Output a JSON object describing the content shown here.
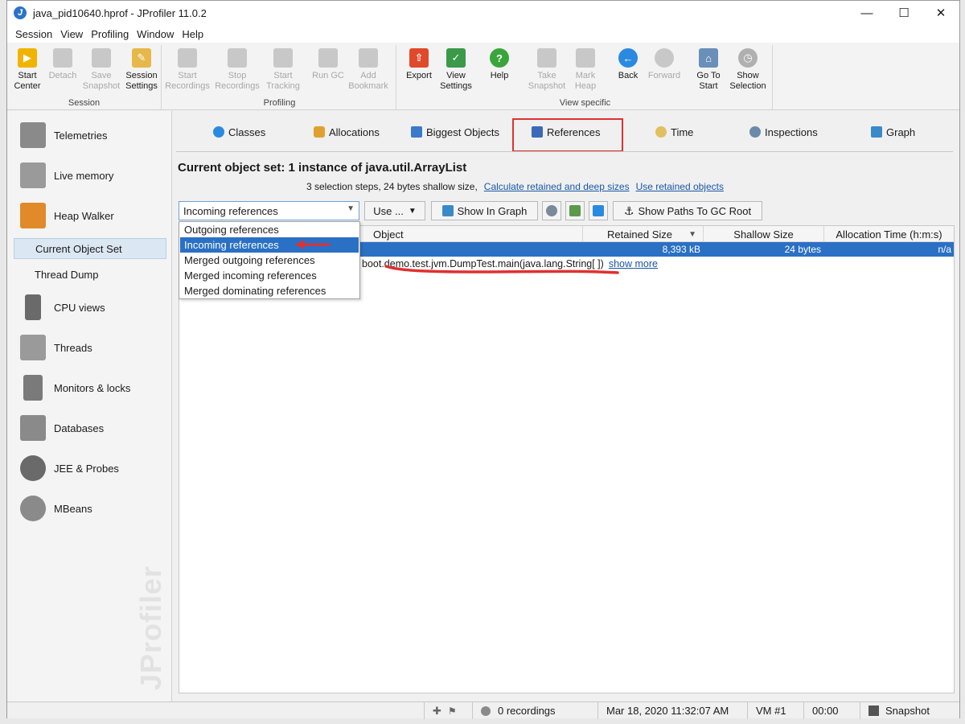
{
  "window": {
    "title": "java_pid10640.hprof - JProfiler 11.0.2"
  },
  "menu": [
    "Session",
    "View",
    "Profiling",
    "Window",
    "Help"
  ],
  "toolbar": {
    "groups": {
      "session": "Session",
      "profiling": "Profiling",
      "view_specific": "View specific"
    },
    "start_center": "Start\nCenter",
    "detach": "Detach",
    "save_snapshot": "Save\nSnapshot",
    "session_settings": "Session\nSettings",
    "start_recordings": "Start\nRecordings",
    "stop_recordings": "Stop\nRecordings",
    "start_tracking": "Start\nTracking",
    "run_gc": "Run GC",
    "add_bookmark": "Add\nBookmark",
    "export": "Export",
    "view_settings": "View\nSettings",
    "help": "Help",
    "take_snapshot": "Take\nSnapshot",
    "mark_heap": "Mark\nHeap",
    "back": "Back",
    "forward": "Forward",
    "go_to_start": "Go To\nStart",
    "show_selection": "Show\nSelection"
  },
  "sidebar": {
    "telemetries": "Telemetries",
    "live_memory": "Live memory",
    "heap_walker": "Heap Walker",
    "current_object_set": "Current Object Set",
    "thread_dump": "Thread Dump",
    "cpu_views": "CPU views",
    "threads": "Threads",
    "monitors_locks": "Monitors & locks",
    "databases": "Databases",
    "jee_probes": "JEE & Probes",
    "mbeans": "MBeans",
    "watermark": "JProfiler"
  },
  "tabs": {
    "classes": "Classes",
    "allocations": "Allocations",
    "biggest_objects": "Biggest Objects",
    "references": "References",
    "time": "Time",
    "inspections": "Inspections",
    "graph": "Graph"
  },
  "content": {
    "title": "Current object set:  1 instance of java.util.ArrayList",
    "steps": "3 selection steps, 24 bytes shallow size,",
    "link_calc": "Calculate retained and deep sizes",
    "link_use": "Use retained objects",
    "combo_value": "Incoming references",
    "use_button": "Use ...",
    "show_in_graph": "Show In Graph",
    "show_paths": "Show Paths To GC Root"
  },
  "table": {
    "headers": {
      "object": "Object",
      "retained": "Retained Size",
      "shallow": "Shallow Size",
      "alloc_time": "Allocation Time (h:m:s)"
    },
    "row": {
      "retained": "8,393 kB",
      "shallow": "24 bytes",
      "alloc_time": "n/a"
    },
    "path_text": "boot.demo.test.jvm.DumpTest.main(java.lang.String[ ])",
    "show_more": "show more"
  },
  "dropdown": {
    "options": [
      "Outgoing references",
      "Incoming references",
      "Merged outgoing references",
      "Merged incoming references",
      "Merged dominating references"
    ],
    "selected": 1
  },
  "statusbar": {
    "recordings": "0 recordings",
    "timestamp": "Mar 18, 2020 11:32:07 AM",
    "vm": "VM #1",
    "time": "00:00",
    "snapshot": "Snapshot"
  },
  "colors": {
    "selection": "#2a70c4",
    "annotation": "#e03030",
    "link": "#1a57a8"
  }
}
